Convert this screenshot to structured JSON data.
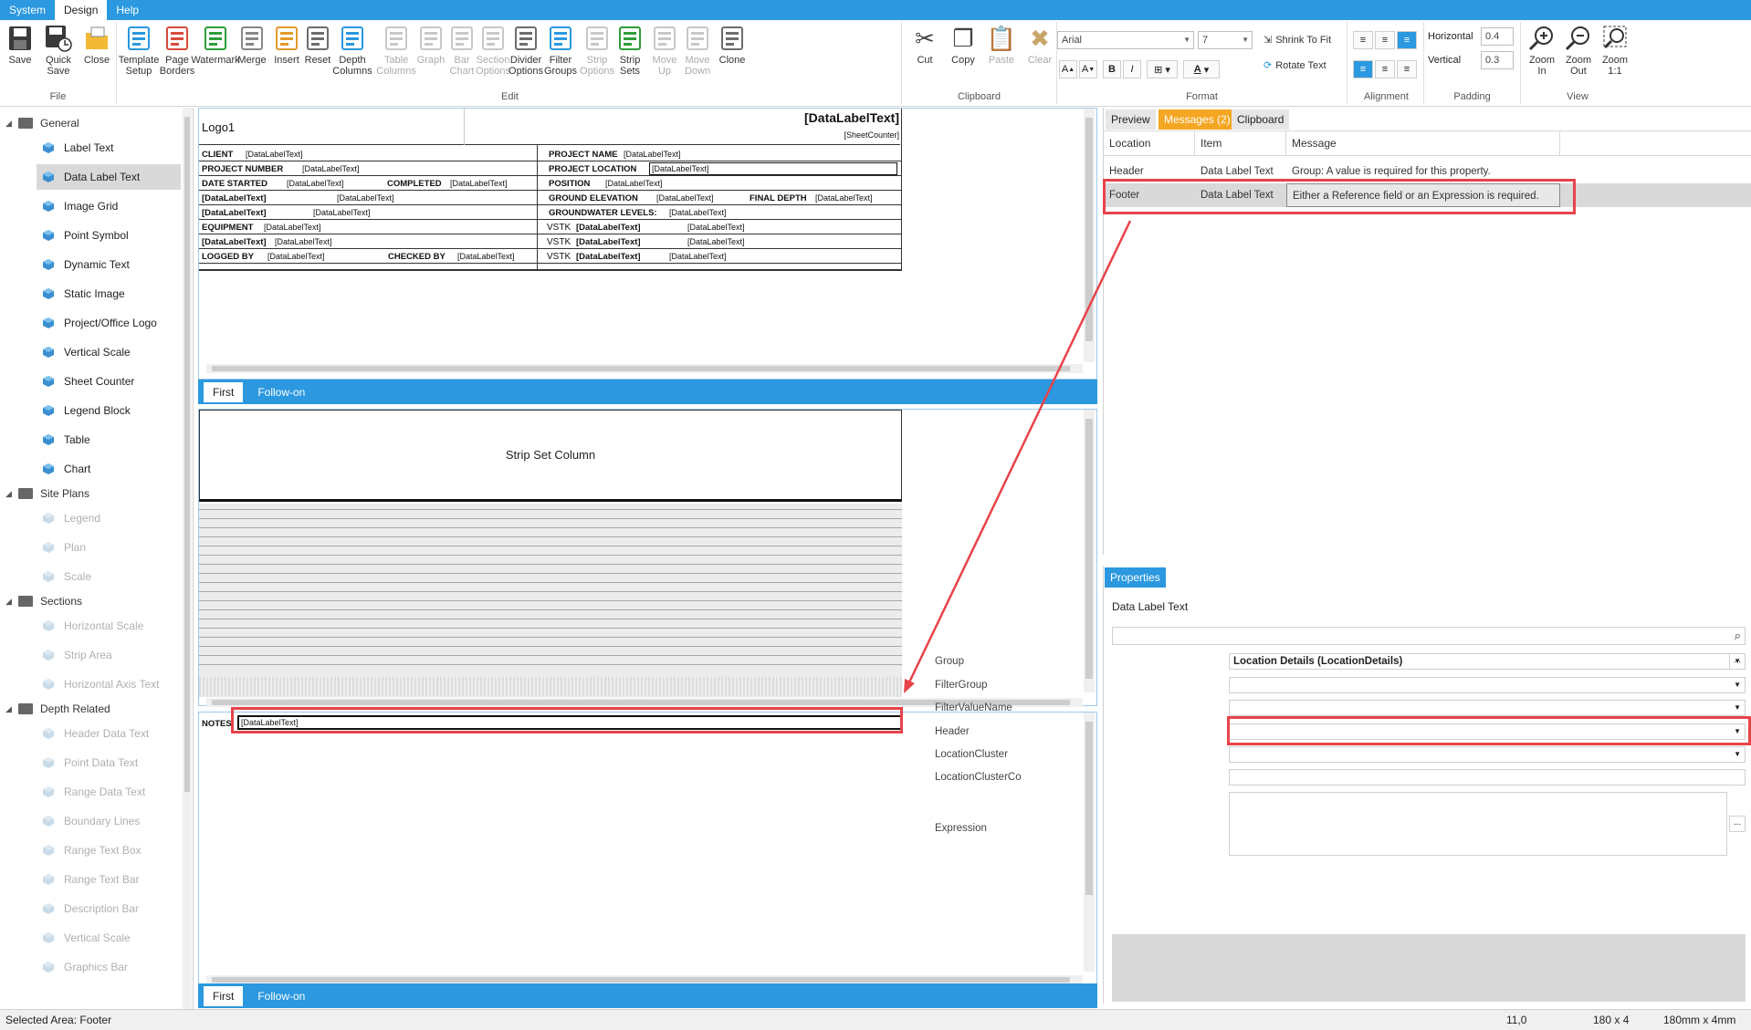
{
  "menu": {
    "tabs": [
      "System",
      "Design",
      "Help"
    ],
    "active": "Design"
  },
  "ribbon": {
    "file": {
      "label": "File",
      "buttons": [
        "Save",
        "Quick\nSave",
        "Close"
      ]
    },
    "edit": {
      "label": "Edit",
      "buttons": [
        "Template\nSetup",
        "Page\nBorders",
        "Watermark",
        "Merge",
        "Insert",
        "Reset",
        "Depth\nColumns",
        "Table\nColumns",
        "Graph",
        "Bar\nChart",
        "Section\nOptions",
        "Divider\nOptions",
        "Filter\nGroups",
        "Strip\nOptions",
        "Strip\nSets",
        "Move\nUp",
        "Move\nDown",
        "Clone"
      ]
    },
    "clipboard": {
      "label": "Clipboard",
      "buttons": [
        "Cut",
        "Copy",
        "Paste",
        "Clear"
      ]
    },
    "format": {
      "label": "Format",
      "font": "Arial",
      "size": "7",
      "shrink": "Shrink To Fit",
      "rotate": "Rotate Text",
      "bold": "B",
      "italic": "I",
      "grow": "A",
      "shrink_font": "A",
      "color": "A"
    },
    "alignment": {
      "label": "Alignment"
    },
    "padding": {
      "label": "Padding",
      "horizontal_label": "Horizontal",
      "horizontal": "0.4",
      "vertical_label": "Vertical",
      "vertical": "0.3"
    },
    "view": {
      "label": "View",
      "buttons": [
        "Zoom\nIn",
        "Zoom\nOut",
        "Zoom\n1:1"
      ]
    }
  },
  "tree": {
    "groups": [
      {
        "label": "General",
        "items": [
          "Label Text",
          "Data Label Text",
          "Image Grid",
          "Point Symbol",
          "Dynamic Text",
          "Static Image",
          "Project/Office Logo",
          "Vertical Scale",
          "Sheet Counter",
          "Legend Block",
          "Table",
          "Chart"
        ]
      },
      {
        "label": "Site Plans",
        "items": [
          "Legend",
          "Plan",
          "Scale"
        ]
      },
      {
        "label": "Sections",
        "items": [
          "Horizontal Scale",
          "Strip Area",
          "Horizontal Axis Text"
        ]
      },
      {
        "label": "Depth Related",
        "items": [
          "Header Data Text",
          "Point Data Text",
          "Range Data Text",
          "Boundary Lines",
          "Range Text Box",
          "Range Text Bar",
          "Description Bar",
          "Vertical Scale",
          "Graphics Bar"
        ]
      }
    ],
    "selected": "Data Label Text"
  },
  "header_sheet": {
    "logo": "Logo1",
    "title": "[DataLabelText]",
    "counter": "[SheetCounter]",
    "dlt": "[DataLabelText]",
    "labels": {
      "client": "CLIENT",
      "project_number": "PROJECT NUMBER",
      "date_started": "DATE STARTED",
      "completed": "COMPLETED",
      "equipment": "EQUIPMENT",
      "logged_by": "LOGGED BY",
      "checked_by": "CHECKED BY",
      "project_name": "PROJECT NAME",
      "project_location": "PROJECT LOCATION",
      "position": "POSITION",
      "ground_elevation": "GROUND ELEVATION",
      "final_depth": "FINAL DEPTH",
      "groundwater_levels": "GROUNDWATER LEVELS:",
      "vstk": "VSTK"
    }
  },
  "tabs": {
    "first": "First",
    "follow_on": "Follow-on"
  },
  "strip": {
    "column_label": "Strip Set Column"
  },
  "footer_sheet": {
    "notes_label": "NOTES",
    "notes_value": "[DataLabelText]"
  },
  "right_tabs": {
    "preview": "Preview",
    "messages": "Messages (2)",
    "clipboard": "Clipboard"
  },
  "messages": {
    "columns": [
      "Location",
      "Item",
      "Message"
    ],
    "rows": [
      {
        "location": "Header",
        "item": "Data Label Text",
        "message": "Group: A value is required for this property."
      },
      {
        "location": "Footer",
        "item": "Data Label Text",
        "message": "Either a Reference field or an Expression is required."
      }
    ]
  },
  "properties": {
    "tab": "Properties",
    "title": "Data Label Text",
    "fields": [
      {
        "label": "Group",
        "value": "Location Details (LocationDetails)"
      },
      {
        "label": "FilterGroup",
        "value": ""
      },
      {
        "label": "FilterValueName",
        "value": ""
      },
      {
        "label": "Header",
        "value": ""
      },
      {
        "label": "LocationCluster",
        "value": ""
      },
      {
        "label": "LocationClusterCo",
        "value": ""
      },
      {
        "label": "Expression",
        "value": ""
      }
    ]
  },
  "status": {
    "selected_area": "Selected Area: Footer",
    "coords": "11,0",
    "size": "180 x 4",
    "mm": "180mm x 4mm"
  },
  "colors": {
    "accent": "#2b98df",
    "highlight": "#e8434a",
    "messages_tab": "#f5a623"
  }
}
